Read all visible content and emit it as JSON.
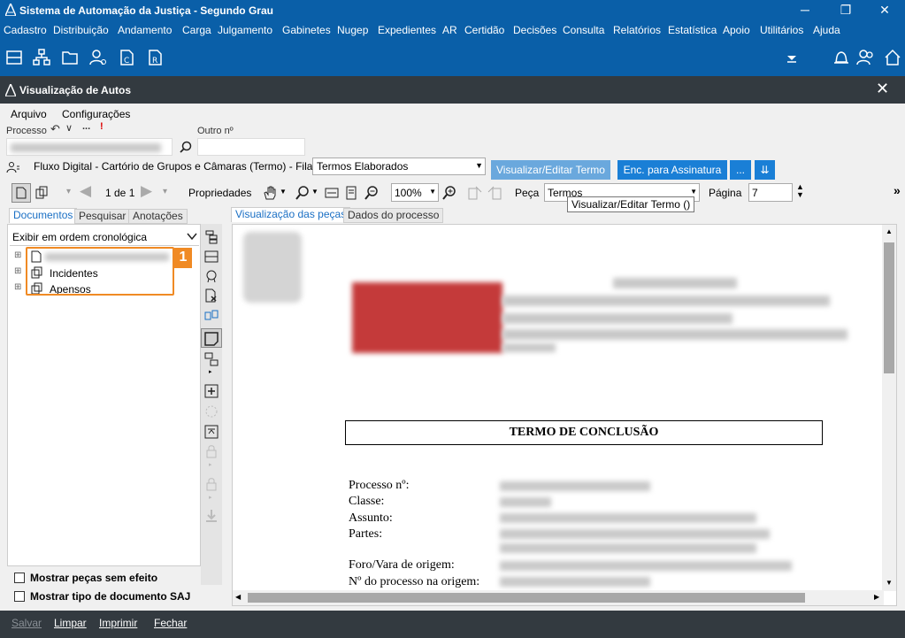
{
  "window": {
    "title": "Sistema de Automação da Justiça - Segundo Grau",
    "controls": {
      "minimize": "─",
      "restore": "❐",
      "close": "✕"
    }
  },
  "menu": [
    "Cadastro",
    "Distribuição",
    "Andamento",
    "Carga",
    "Julgamento",
    "Gabinetes",
    "Nugep",
    "Expedientes",
    "AR",
    "Certidão",
    "Decisões",
    "Consulta",
    "Relatórios",
    "Estatística",
    "Apoio",
    "Utilitários",
    "Ajuda"
  ],
  "subwindow": {
    "title": "Visualização de Autos",
    "close": "✕"
  },
  "menu2": {
    "arquivo": "Arquivo",
    "configuracoes": "Configurações"
  },
  "processo": {
    "label": "Processo",
    "outro_label": "Outro nº",
    "undo": "↶",
    "chev": "∨",
    "more": "...",
    "alert": "!"
  },
  "fluxo": {
    "text": "Fluxo Digital - Cartório de Grupos e Câmaras (Termo) - Fila:",
    "fila_value": "Termos Elaborados",
    "btn_visualizar": "Visualizar/Editar Termo",
    "btn_enc": "Enc. para Assinatura",
    "btn_more": "...",
    "btn_filter": "⇊"
  },
  "toolbar": {
    "pagina_de": "1 de 1",
    "propriedades": "Propriedades",
    "zoom": "100%",
    "peca_label": "Peça",
    "peca_value": "Termos",
    "pagina_label": "Página",
    "pagina_value": "7",
    "tooltip": "Visualizar/Editar Termo ()",
    "overflow": "»"
  },
  "left_tabs": {
    "documentos": "Documentos",
    "pesquisar": "Pesquisar",
    "anotacoes": "Anotações"
  },
  "order_select": "Exibir em ordem cronológica",
  "tree": {
    "item2": "Incidentes",
    "item3": "Apensos",
    "expand": "⊞"
  },
  "annotation_badge": "1",
  "checkboxes": {
    "sem_efeito": "Mostrar peças sem efeito",
    "tipo_saj": "Mostrar tipo de documento SAJ"
  },
  "doc_tabs": {
    "visualizacao": "Visualização das peças",
    "dados": "Dados do processo"
  },
  "document": {
    "heading": "TERMO DE CONCLUSÃO",
    "fields": [
      "Processo nº:",
      "Classe:",
      "Assunto:",
      "Partes:",
      "",
      "Foro/Vara de origem:",
      "Nº do processo na origem:"
    ]
  },
  "bottom": {
    "salvar": "Salvar",
    "limpar": "Limpar",
    "imprimir": "Imprimir",
    "fechar": "Fechar"
  },
  "colors": {
    "titlebar": "#0a5fa8",
    "dark": "#333a40",
    "accent": "#1a7fd6",
    "highlight": "#f08a24"
  }
}
